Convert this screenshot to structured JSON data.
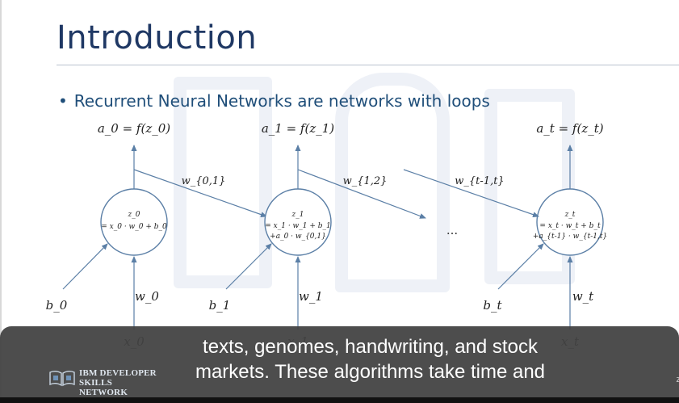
{
  "slide": {
    "title": "Introduction",
    "bullet": "Recurrent Neural Networks are networks with loops",
    "bullet_marker": "•",
    "colors": {
      "title": "#1f3864",
      "bullet": "#1f4e79",
      "diagram_line": "#5b7fa6",
      "caption_bg": "#424242"
    }
  },
  "diagram": {
    "outputs": [
      "a_0 = f(z_0)",
      "a_1 = f(z_1)",
      "a_t = f(z_t)"
    ],
    "recurrent_weights": [
      "w_{0,1}",
      "w_{1,2}",
      "w_{t-1,t}"
    ],
    "nodes": [
      {
        "z": "z_0",
        "eq1": "= x_0 · w_0 + b_0",
        "eq2": ""
      },
      {
        "z": "z_1",
        "eq1": "= x_1 · w_1 + b_1",
        "eq2": "+a_0 · w_{0,1}"
      },
      {
        "z": "z_t",
        "eq1": "= x_t · w_t + b_t",
        "eq2": "+a_{t-1} · w_{t-1,t}"
      }
    ],
    "biases": [
      "b_0",
      "b_1",
      "b_t"
    ],
    "input_weights": [
      "w_0",
      "w_1",
      "w_t"
    ],
    "inputs": [
      "x_0",
      "x_1",
      "x_t"
    ],
    "ellipsis": "..."
  },
  "caption": {
    "line1": "texts, genomes, handwriting, and stock",
    "line2": "markets. These algorithms take time and"
  },
  "brand": {
    "line1": "IBM DEVELOPER",
    "line2": "SKILLS NETWORK",
    "icon": "ibm-developer-logo-icon"
  },
  "page_fragment": "z"
}
